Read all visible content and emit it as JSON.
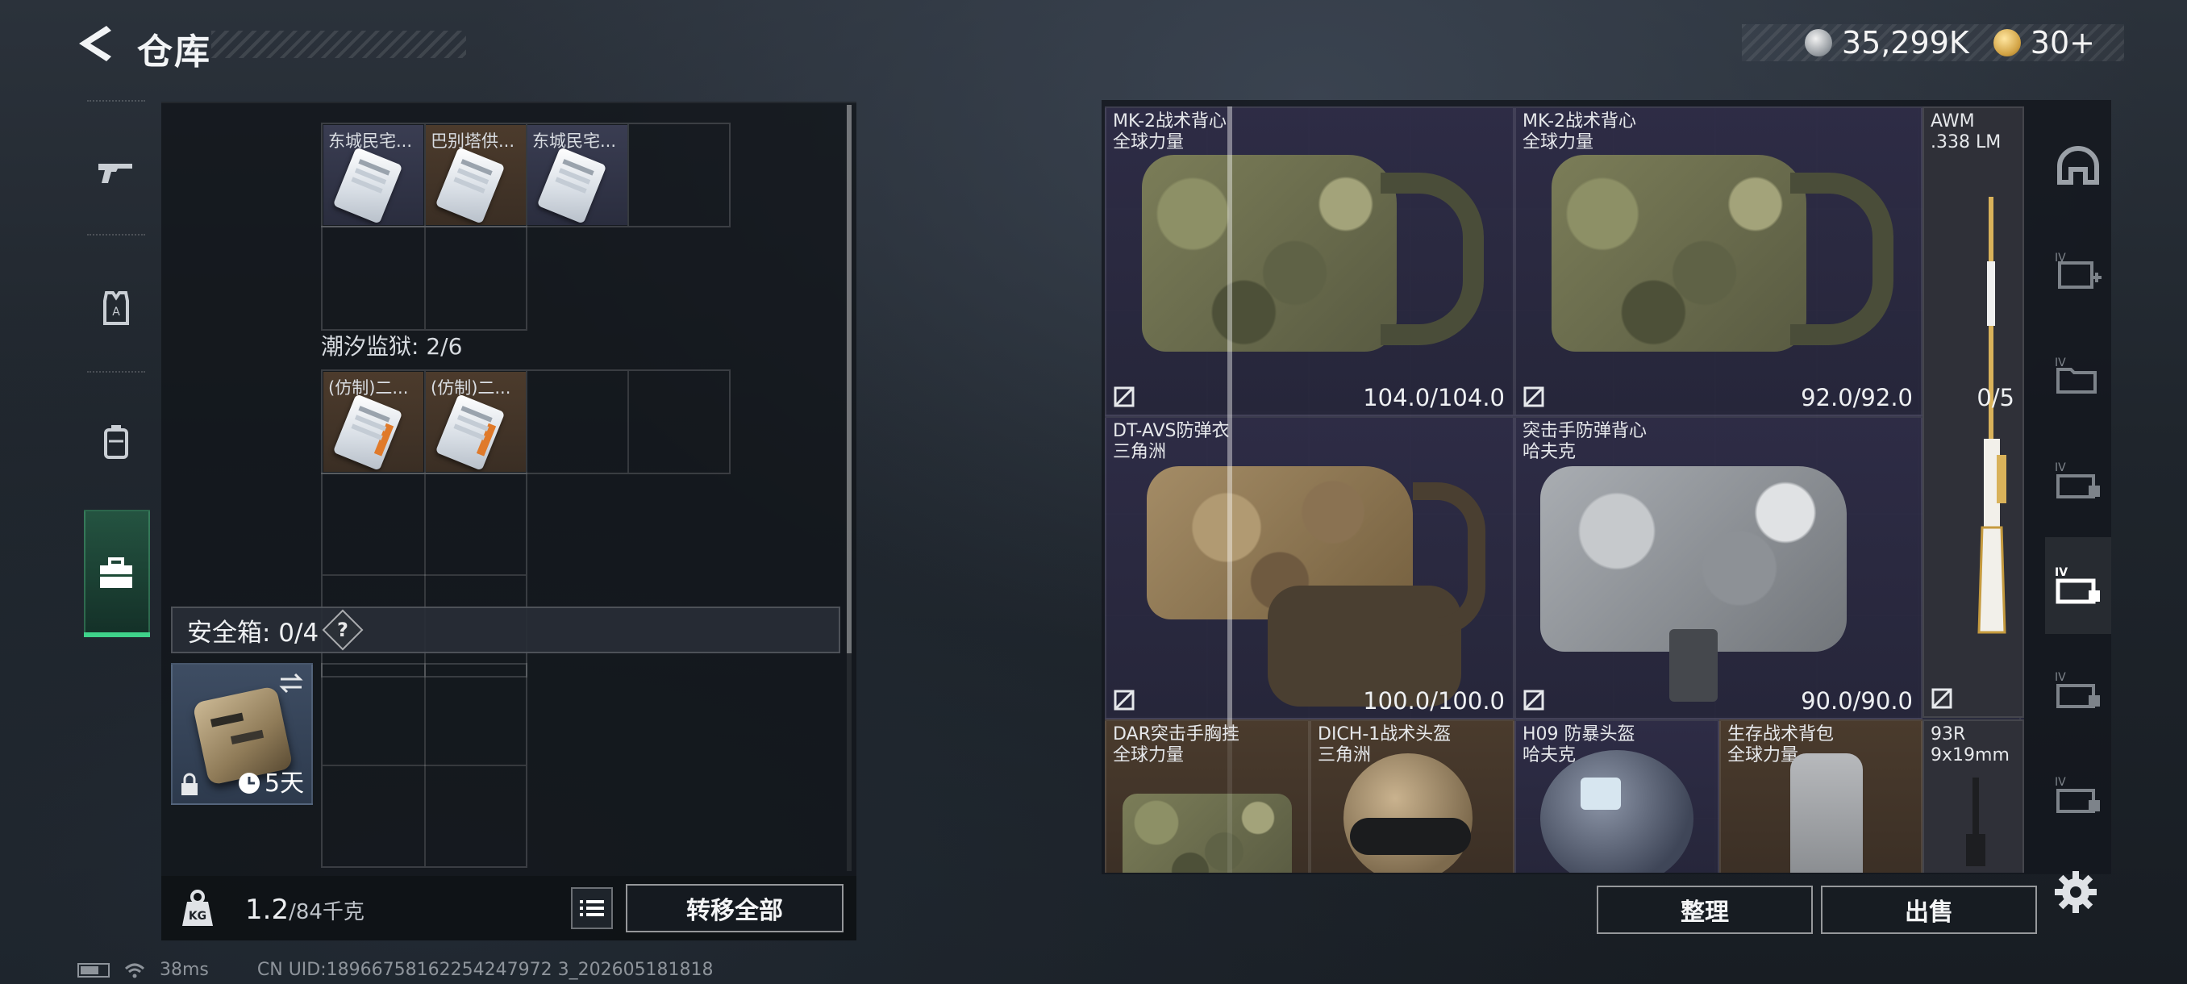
{
  "header": {
    "title": "仓库",
    "currencies": [
      {
        "icon": "silver-coin-icon",
        "value": "35,299K"
      },
      {
        "icon": "gold-coin-icon",
        "value": "30+"
      }
    ]
  },
  "sidebar": {
    "tabs": [
      {
        "icon": "gun-icon",
        "label": "weapons"
      },
      {
        "icon": "armor-icon",
        "label": "armor"
      },
      {
        "icon": "backpack-icon",
        "label": "backpack"
      },
      {
        "icon": "toolbox-icon",
        "label": "storage",
        "active": true
      }
    ]
  },
  "left_panel": {
    "section_keycards_1": {
      "items": [
        {
          "label": "东城民宅...",
          "color": "blue"
        },
        {
          "label": "巴别塔供...",
          "color": "brown"
        },
        {
          "label": "东城民宅...",
          "color": "blue"
        }
      ]
    },
    "section_prison": {
      "label": "潮汐监狱: 2/6",
      "items": [
        {
          "label": "(仿制)二...",
          "color": "brown"
        },
        {
          "label": "(仿制)二...",
          "color": "brown"
        }
      ]
    },
    "safe_box": {
      "label": "安全箱: 0/4",
      "help": "?",
      "duration": "5天"
    },
    "weight": {
      "value": "1.2",
      "max": "/84千克"
    },
    "transfer_all": "转移全部"
  },
  "status": {
    "ping": "38ms",
    "uid": "CN UID:18966758162254247972 3_202605181818"
  },
  "stash": {
    "items": [
      {
        "name": "MK-2战术背心",
        "sub": "全球力量",
        "durability": "104.0/104.0"
      },
      {
        "name": "MK-2战术背心",
        "sub": "全球力量",
        "durability": "92.0/92.0"
      },
      {
        "name": "AWM",
        "sub": ".338 LM",
        "count": "0/5"
      },
      {
        "name": "DT-AVS防弹衣",
        "sub": "三角洲",
        "durability": "100.0/100.0"
      },
      {
        "name": "突击手防弹背心",
        "sub": "哈夫克",
        "durability": "90.0/90.0"
      },
      {
        "name": "DAR突击手胸挂",
        "sub": "全球力量"
      },
      {
        "name": "DICH-1战术头盔",
        "sub": "三角洲"
      },
      {
        "name": "H09 防暴头盔",
        "sub": "哈夫克"
      },
      {
        "name": "生存战术背包",
        "sub": "全球力量"
      },
      {
        "name": "93R",
        "sub": "9x19mm"
      }
    ],
    "sort": "整理",
    "sell": "出售"
  },
  "categories": [
    {
      "icon": "helmet-icon"
    },
    {
      "icon": "medkit-iv-icon"
    },
    {
      "icon": "folder-iv-icon"
    },
    {
      "icon": "case-iv-icon"
    },
    {
      "icon": "case-iv-active-icon",
      "active": true
    },
    {
      "icon": "case-iv-icon"
    },
    {
      "icon": "case-iv-icon"
    }
  ],
  "colors": {
    "accent_green": "#3fd28a",
    "grid_purple": "#2a2b3e",
    "item_brown": "#4a3b2d"
  }
}
